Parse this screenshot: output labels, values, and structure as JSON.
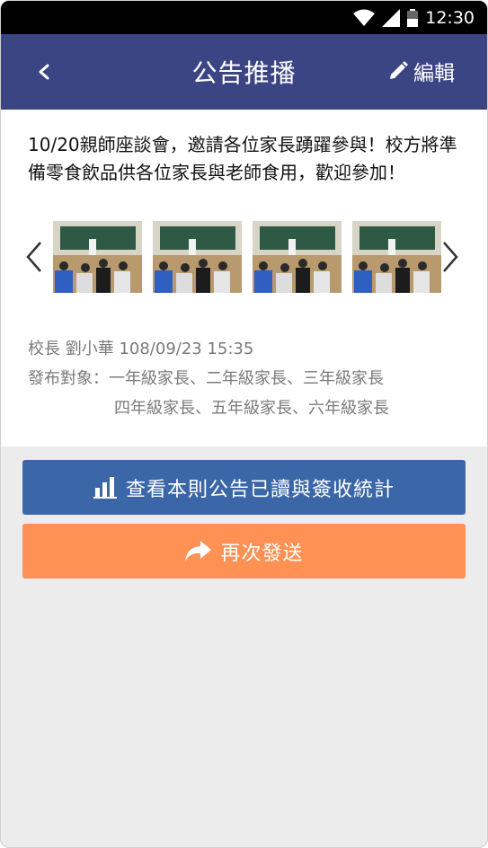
{
  "status_bar": {
    "time": "12:30"
  },
  "app_bar": {
    "title": "公告推播",
    "edit_label": "編輯"
  },
  "announcement": {
    "message": "10/20親師座談會，邀請各位家長踴躍參與！校方將準備零食飲品供各位家長與老師食用，歡迎參加！",
    "photos": [
      {
        "name": "classroom-photo-1"
      },
      {
        "name": "classroom-photo-2"
      },
      {
        "name": "classroom-photo-3"
      },
      {
        "name": "classroom-photo-4"
      }
    ],
    "author_line": "校長 劉小華 108/09/23 15:35",
    "targets_label": "發布對象：",
    "targets_line1": "一年級家長、二年級家長、三年級家長",
    "targets_line2": "四年級家長、五年級家長、六年級家長"
  },
  "actions": {
    "stats_label": "查看本則公告已讀與簽收統計",
    "resend_label": "再次發送"
  },
  "colors": {
    "app_bar": "#3b4584",
    "stats_button": "#3b67a8",
    "resend_button": "#ff9154"
  },
  "icons": [
    "wifi-icon",
    "signal-icon",
    "battery-icon",
    "back-icon",
    "pencil-icon",
    "chevron-left-icon",
    "chevron-right-icon",
    "bar-chart-icon",
    "share-arrow-icon"
  ]
}
